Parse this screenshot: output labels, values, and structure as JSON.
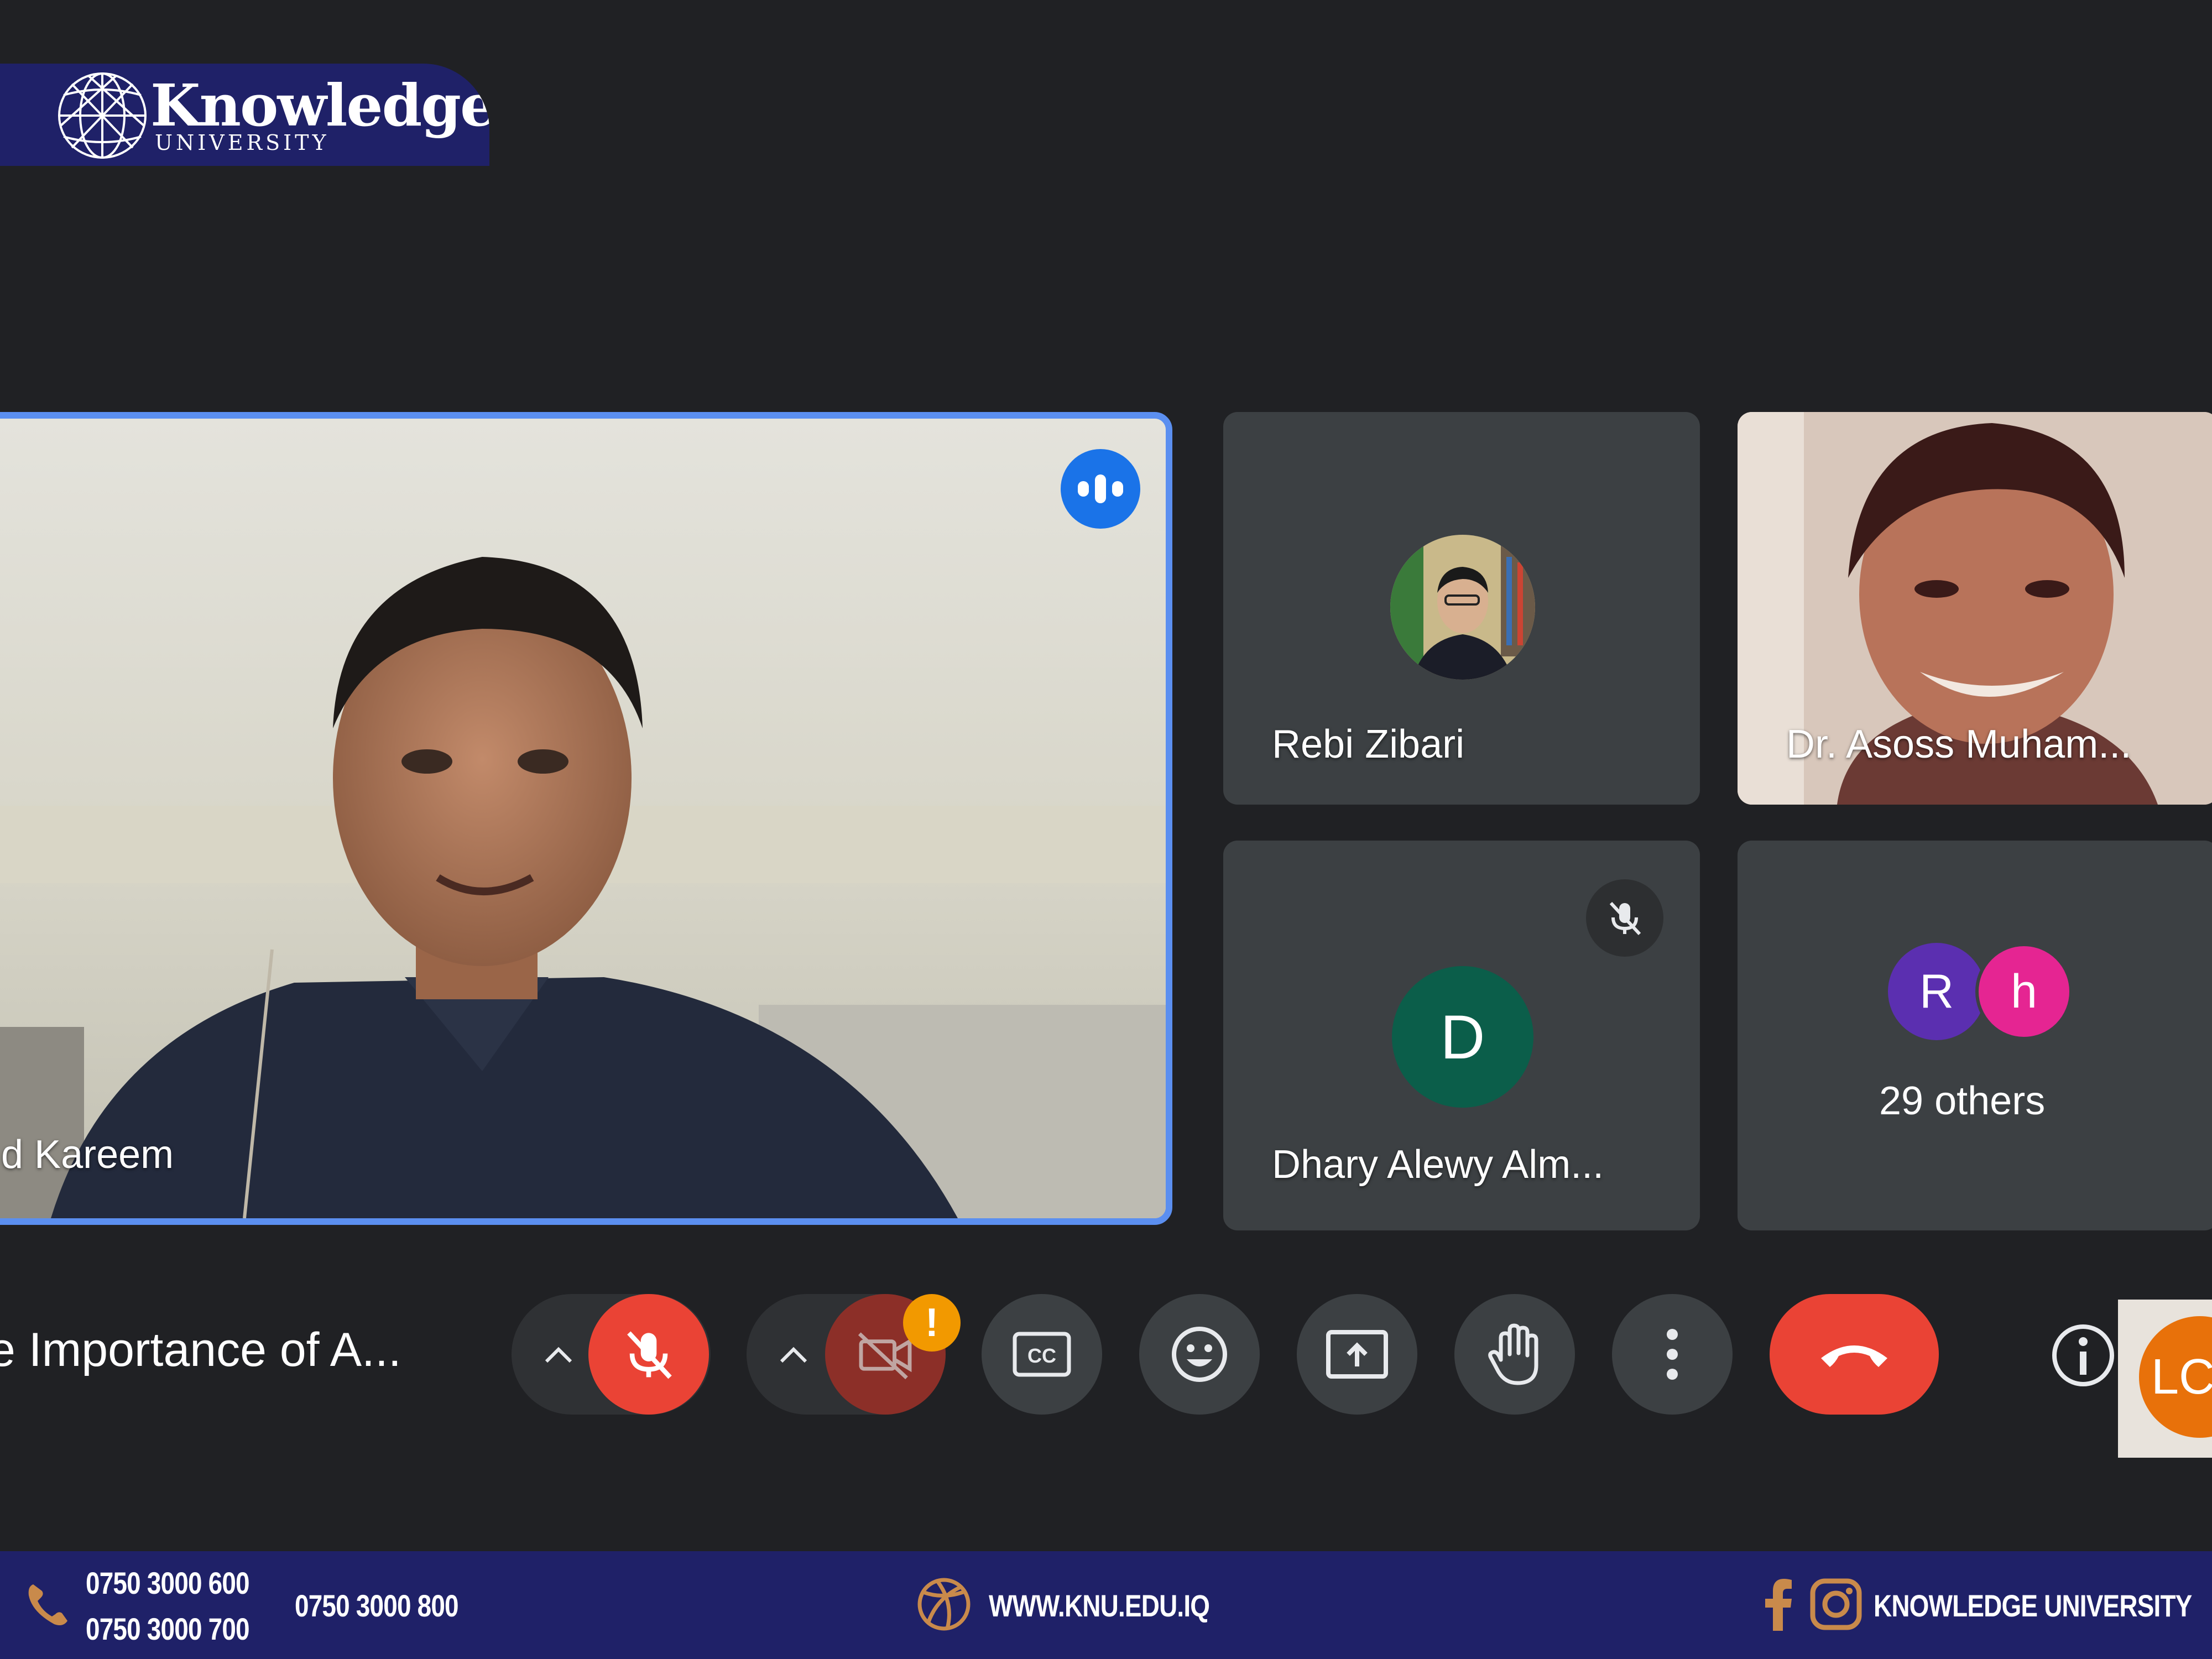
{
  "branding": {
    "logo_name": "Knowledge",
    "logo_sub": "UNIVERSITY",
    "accent_navy": "#1f2168"
  },
  "meeting": {
    "title": "e Importance of A...",
    "participants": [
      {
        "name": "d Kareem",
        "state": "speaking",
        "video": true
      },
      {
        "name": "Rebi Zibari",
        "avatar": "photo"
      },
      {
        "name": "Dr. Asoss Muham...",
        "video": true
      },
      {
        "name": "Dhary Alewy Alm...",
        "avatar_letter": "D",
        "muted": true
      },
      {
        "others_label": "29 others",
        "avatar_letters": [
          "R",
          "h"
        ]
      }
    ],
    "self_avatar": "LC"
  },
  "controls": {
    "mic": "mic-off-icon",
    "camera": "camera-off-icon",
    "captions": "CC",
    "warning": "!"
  },
  "footer": {
    "phone_1": "0750 3000 600",
    "phone_2": "0750 3000 700",
    "phone_3": "0750 3000 800",
    "website": "WWW.KNU.EDU.IQ",
    "social": "KNOWLEDGE UNIVERSITY"
  }
}
